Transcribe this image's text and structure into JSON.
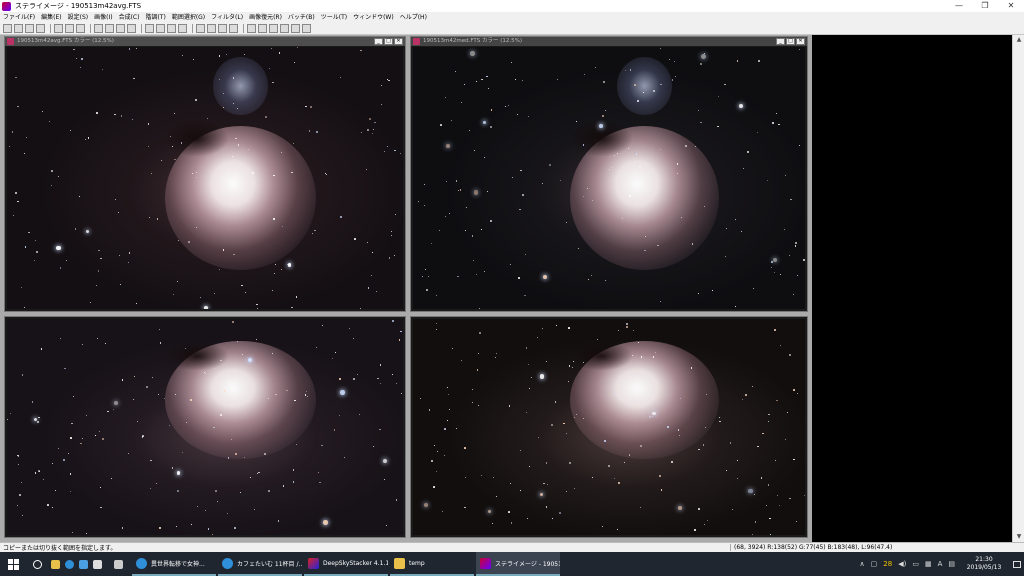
{
  "window": {
    "title": "ステライメージ - 190513m42avg.FTS",
    "minimize": "—",
    "maximize": "❐",
    "close": "✕"
  },
  "menu": [
    "ファイル(F)",
    "編集(E)",
    "設定(S)",
    "画像(I)",
    "合成(C)",
    "階調(T)",
    "範囲選択(G)",
    "フィルタ(L)",
    "画像復元(R)",
    "バッチ(B)",
    "ツール(T)",
    "ウィンドウ(W)",
    "ヘルプ(H)"
  ],
  "toolbar_icons": [
    "new-icon",
    "open-icon",
    "save-icon",
    "print-icon",
    "copy-icon",
    "paste-icon",
    "undo-icon",
    "select-icon",
    "text-icon",
    "stretch-icon",
    "levels-icon",
    "histogram-icon",
    "curve-icon",
    "color-icon",
    "filter-icon",
    "zoom-in-icon",
    "zoom-out-icon",
    "fit-icon",
    "star-icon",
    "grid-icon",
    "info-icon",
    "crop-icon",
    "rotate-icon",
    "flip-icon",
    "pointer-icon"
  ],
  "children": [
    {
      "title": "190513m42avg.FTS カラー (12.5%)",
      "min": "_",
      "max": "□",
      "close": "✕"
    },
    {
      "title": "190513m42med.FTS カラー (12.5%)",
      "min": "_",
      "max": "□",
      "close": "✕"
    },
    {
      "title": ""
    },
    {
      "title": ""
    }
  ],
  "status": {
    "message": "コピーまたは切り抜く範囲を指定します。",
    "coords": "(68, 3924) R:138(52) G:77(45) B:183(48), L:96(47.4)"
  },
  "taskbar": {
    "tasks": [
      {
        "label": "異世界転移で女神..."
      },
      {
        "label": "カフェたいむ 11杯目 /..."
      },
      {
        "label": "DeepSkyStacker 4.1.1"
      },
      {
        "label": "temp"
      },
      {
        "label": "ステライメージ - 19051..."
      }
    ],
    "tray_count": "28",
    "ime": "A",
    "time": "21:30",
    "date": "2019/05/13"
  }
}
